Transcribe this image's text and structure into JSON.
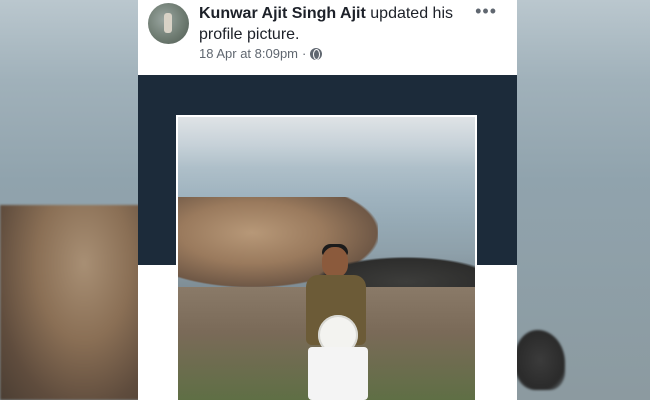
{
  "post": {
    "author": "Kunwar Ajit Singh Ajit",
    "action": "updated his profile picture.",
    "timestamp": "18 Apr at 8:09pm",
    "separator": "·",
    "privacy_icon": "globe-icon",
    "more_icon": "more-options-icon"
  },
  "colors": {
    "cover": "#1c2b3a",
    "text_primary": "#1d2129",
    "text_secondary": "#606770",
    "card": "#ffffff"
  }
}
